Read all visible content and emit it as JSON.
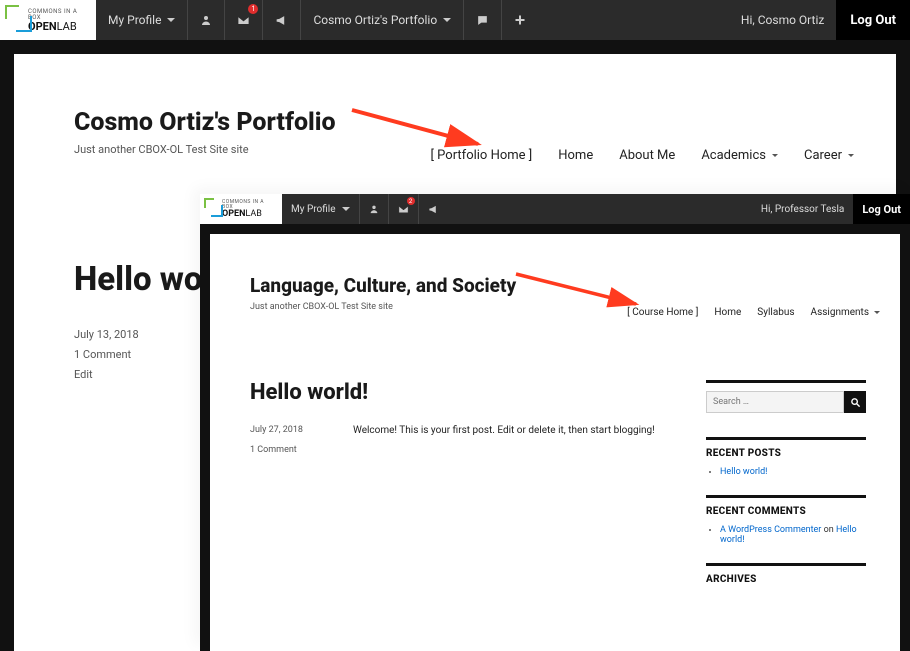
{
  "logo": {
    "line1": "COMMONS IN A BOX",
    "line2a": "OPEN",
    "line2b": "LAB"
  },
  "outer": {
    "adminbar": {
      "myprofile": "My Profile",
      "portfolio": "Cosmo Ortiz's Portfolio",
      "greeting": "Hi, Cosmo Ortiz",
      "logout": "Log Out",
      "notif_count": "1"
    },
    "site_title": "Cosmo Ortiz's Portfolio",
    "site_tagline": "Just another CBOX-OL Test Site site",
    "nav": {
      "home_link": "[ Portfolio Home ]",
      "items": [
        "Home",
        "About Me",
        "Academics",
        "Career"
      ],
      "has_submenu": [
        false,
        false,
        true,
        true
      ]
    },
    "post": {
      "title": "Hello wor",
      "date": "July 13, 2018",
      "comments": "1 Comment",
      "edit": "Edit"
    }
  },
  "inner": {
    "adminbar": {
      "myprofile": "My Profile",
      "greeting": "Hi, Professor Tesla",
      "logout": "Log Out",
      "notif_count": "2"
    },
    "site_title": "Language, Culture, and Society",
    "site_tagline": "Just another CBOX-OL Test Site site",
    "nav": {
      "home_link": "[ Course Home ]",
      "items": [
        "Home",
        "Syllabus",
        "Assignments"
      ],
      "has_submenu": [
        false,
        false,
        true
      ]
    },
    "post": {
      "title": "Hello world!",
      "date": "July 27, 2018",
      "comments": "1 Comment",
      "excerpt": "Welcome! This is your first post. Edit or delete it, then start blogging!"
    },
    "sidebar": {
      "search_placeholder": "Search …",
      "recent_posts_title": "RECENT POSTS",
      "recent_posts": [
        "Hello world!"
      ],
      "recent_comments_title": "RECENT COMMENTS",
      "recent_comments": [
        {
          "author": "A WordPress Commenter",
          "on": " on ",
          "post": "Hello world!"
        }
      ],
      "archives_title": "ARCHIVES"
    }
  }
}
